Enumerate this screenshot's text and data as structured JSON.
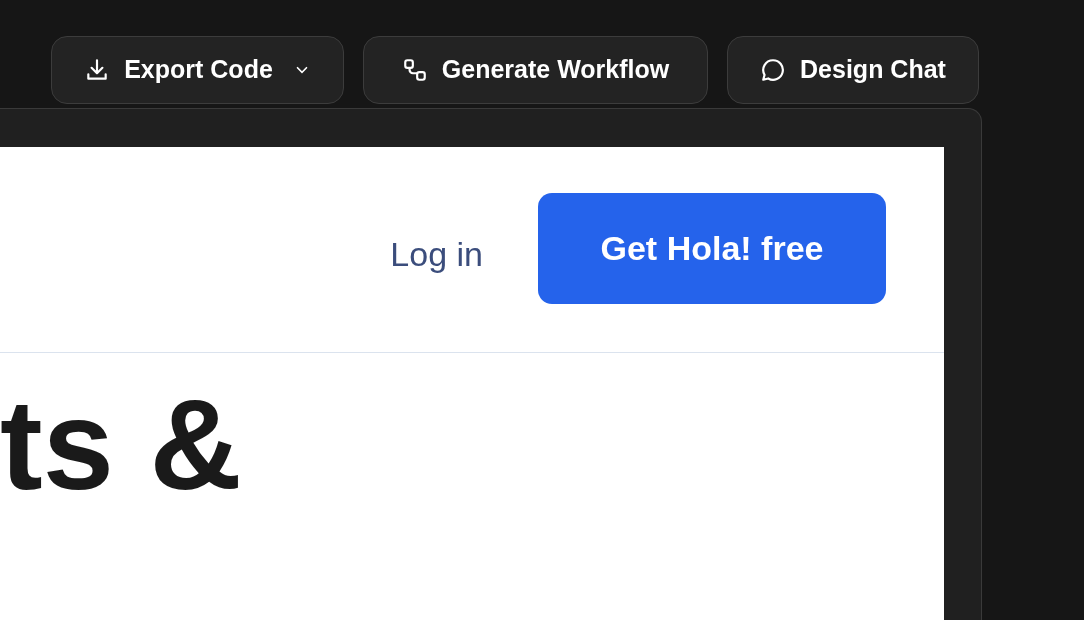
{
  "toolbar": {
    "buttons": [
      {
        "kind": "download",
        "label": "Export Code",
        "dropdown": true
      },
      {
        "kind": "workflow",
        "label": "Generate Workflow",
        "dropdown": false
      },
      {
        "kind": "chat",
        "label": "Design Chat",
        "dropdown": false
      }
    ]
  },
  "preview": {
    "nav": {
      "login": "Log in",
      "cta": "Get Hola! free"
    },
    "heading": "ts &"
  }
}
